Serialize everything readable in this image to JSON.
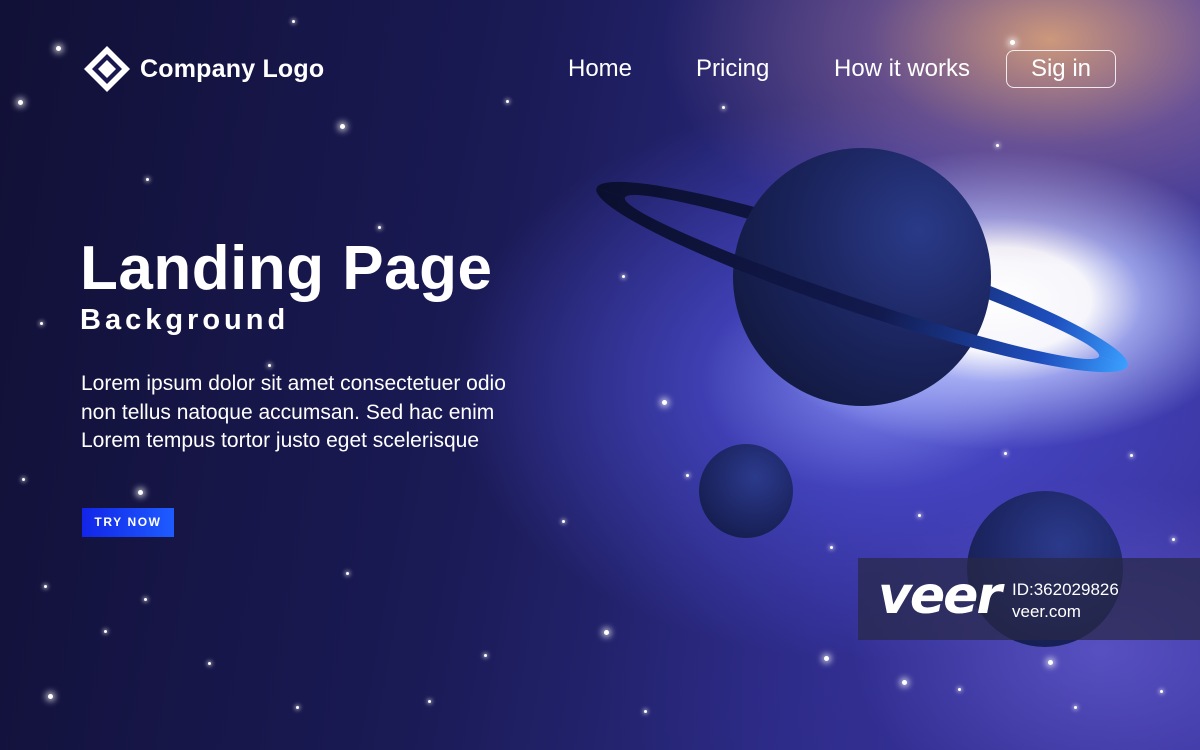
{
  "header": {
    "logo_text": "Company Logo",
    "nav": {
      "home": "Home",
      "pricing": "Pricing",
      "how_it_works": "How it works",
      "sign_in": "Sig in"
    }
  },
  "hero": {
    "title": "Landing Page",
    "subtitle": "Background",
    "body_lines": [
      "Lorem ipsum dolor sit amet consectetuer odio",
      "non tellus natoque accumsan. Sed hac enim",
      "Lorem tempus tortor justo eget scelerisque"
    ],
    "cta_label": "TRY NOW"
  },
  "watermark": {
    "logo": "veer",
    "id_text": "ID:362029826",
    "site": "veer.com"
  },
  "colors": {
    "background_dark": "#14123f",
    "nebula_glow": "#ffffff",
    "nebula_blue": "#5a5ae6",
    "cta_blue": "#1230ee",
    "planet_dark": "#1a2355",
    "ring_highlight": "#3a8dff"
  }
}
